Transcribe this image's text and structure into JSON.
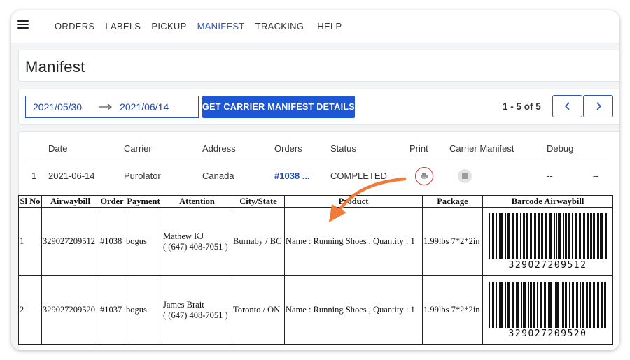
{
  "nav": {
    "items": [
      {
        "label": "ORDERS",
        "active": false
      },
      {
        "label": "LABELS",
        "active": false
      },
      {
        "label": "PICKUP",
        "active": false
      },
      {
        "label": "MANIFEST",
        "active": true
      },
      {
        "label": "TRACKING",
        "active": false
      },
      {
        "label": "HELP",
        "active": false
      }
    ]
  },
  "page": {
    "title": "Manifest"
  },
  "filter": {
    "date_start": "2021/05/30",
    "date_end": "2021/06/14",
    "get_button": "GET CARRIER MANIFEST DETAILS",
    "pager_text": "1 - 5 of 5"
  },
  "results": {
    "headers": [
      "Date",
      "Carrier",
      "Address",
      "Orders",
      "Status",
      "Print",
      "Carrier Manifest",
      "Debug"
    ],
    "row": {
      "index": "1",
      "date": "2021-06-14",
      "carrier": "Purolator",
      "address": "Canada",
      "orders": "#1038 ...",
      "status": "COMPLETED",
      "debug": "--",
      "extra": "--"
    }
  },
  "manifest": {
    "headers": [
      "Sl No",
      "Airwaybill",
      "Order",
      "Payment",
      "Attention",
      "City/State",
      "Product",
      "Package",
      "Barcode Airwaybill"
    ],
    "rows": [
      {
        "sl": "1",
        "airwaybill": "329027209512",
        "order": "#1038",
        "payment": "bogus",
        "attention_name": "Mathew KJ",
        "attention_phone": "( (647) 408-7051 )",
        "city": "Burnaby / BC",
        "product": "Name : Running Shoes , Quantity : 1",
        "package": "1.99lbs 7*2*2in",
        "barcode": "329027209512"
      },
      {
        "sl": "2",
        "airwaybill": "329027209520",
        "order": "#1037",
        "payment": "bogus",
        "attention_name": "James Brait",
        "attention_phone": "( (647) 408-7051 )",
        "city": "Toronto / ON",
        "product": "Name : Running Shoes , Quantity : 1",
        "package": "1.99lbs 7*2*2in",
        "barcode": "329027209520"
      }
    ]
  },
  "colors": {
    "accent": "#1e57d6",
    "link": "#1e48b5",
    "annotation": "#f07a3a",
    "highlight": "#d33333"
  }
}
